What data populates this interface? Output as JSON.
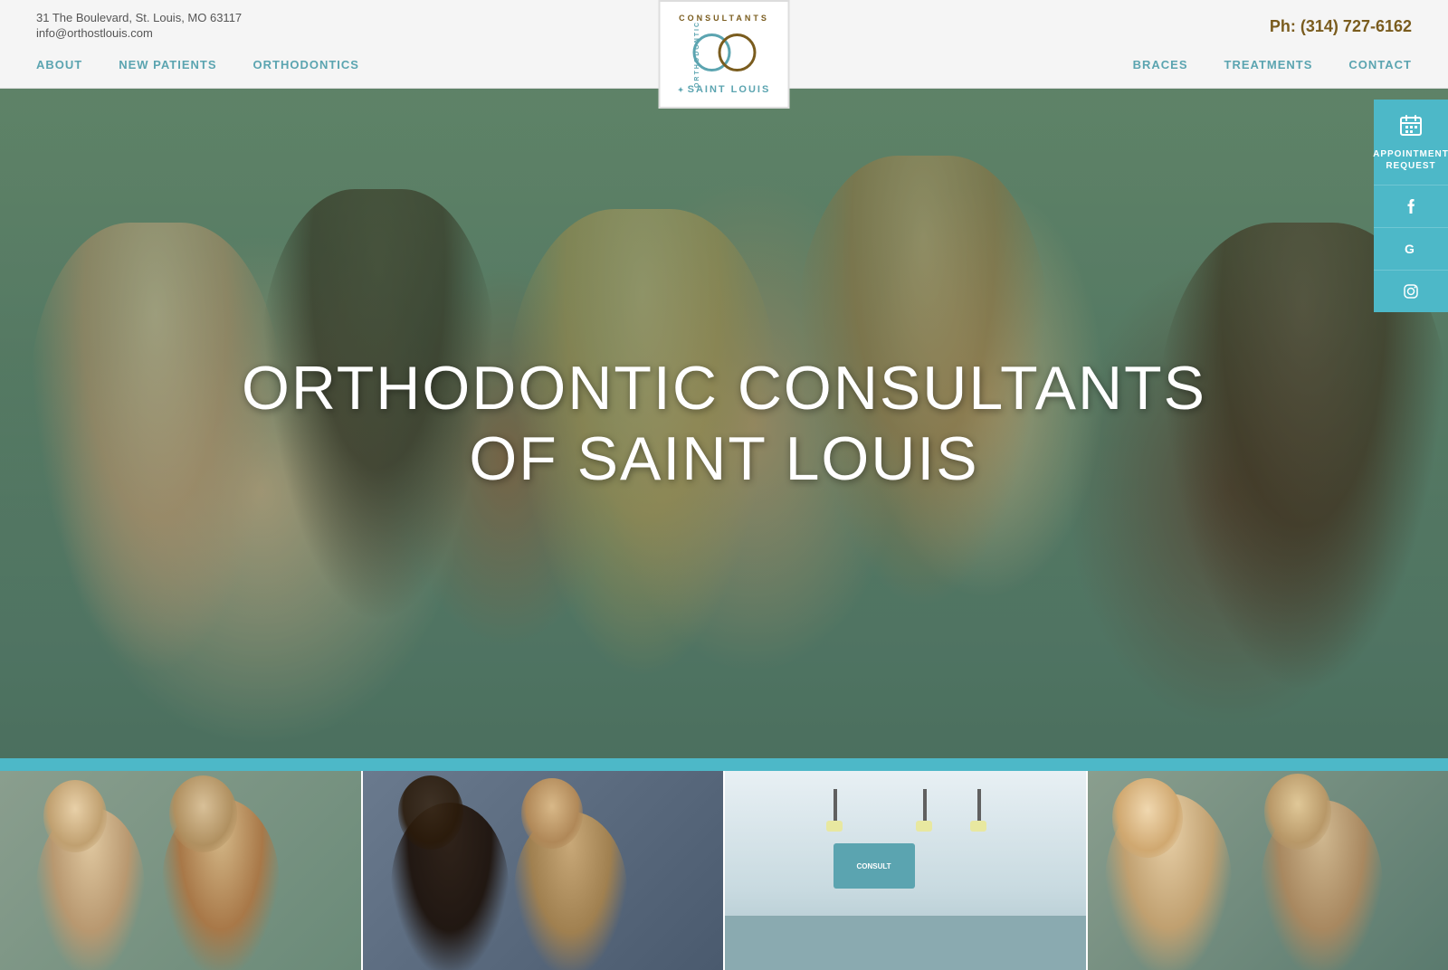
{
  "header": {
    "address": "31 The Boulevard, St. Louis, MO 63117",
    "email": "info@orthostlouis.com",
    "phone_label": "Ph:",
    "phone": "(314) 727-6162"
  },
  "logo": {
    "text_top": "CONSULTANTS",
    "text_middle": "ORTHODONTIC",
    "text_bottom": "SAINT LOUIS"
  },
  "nav": {
    "left": [
      "ABOUT",
      "NEW PATIENTS",
      "ORTHODONTICS"
    ],
    "right": [
      "BRACES",
      "TREATMENTS",
      "CONTACT"
    ]
  },
  "hero": {
    "title_line1": "ORTHODONTIC CONSULTANTS",
    "title_line2": "OF SAINT LOUIS"
  },
  "side_panel": {
    "appointment_icon": "📅",
    "appointment_text": "APPOINTMENT REQUEST",
    "social_facebook": "f",
    "social_google": "G",
    "social_instagram": "⬛"
  },
  "colors": {
    "teal": "#4db8c8",
    "gold": "#7a5c1e",
    "nav_text": "#5ba4b0"
  }
}
